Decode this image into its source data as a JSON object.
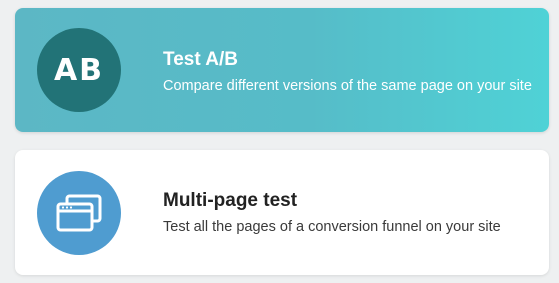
{
  "cards": [
    {
      "badge": "AB",
      "title": "Test A/B",
      "description": "Compare different versions of the same page on your site",
      "selected": true
    },
    {
      "icon": "browser-windows-icon",
      "title": "Multi-page test",
      "description": "Test all the pages of a conversion funnel on your site",
      "selected": false
    }
  ],
  "colors": {
    "ab_card_gradient_start": "#5cb7c5",
    "ab_card_gradient_end": "#4fd2d6",
    "ab_badge": "#227377",
    "multipage_badge": "#4f9cd0",
    "page_background": "#eef0f1"
  }
}
